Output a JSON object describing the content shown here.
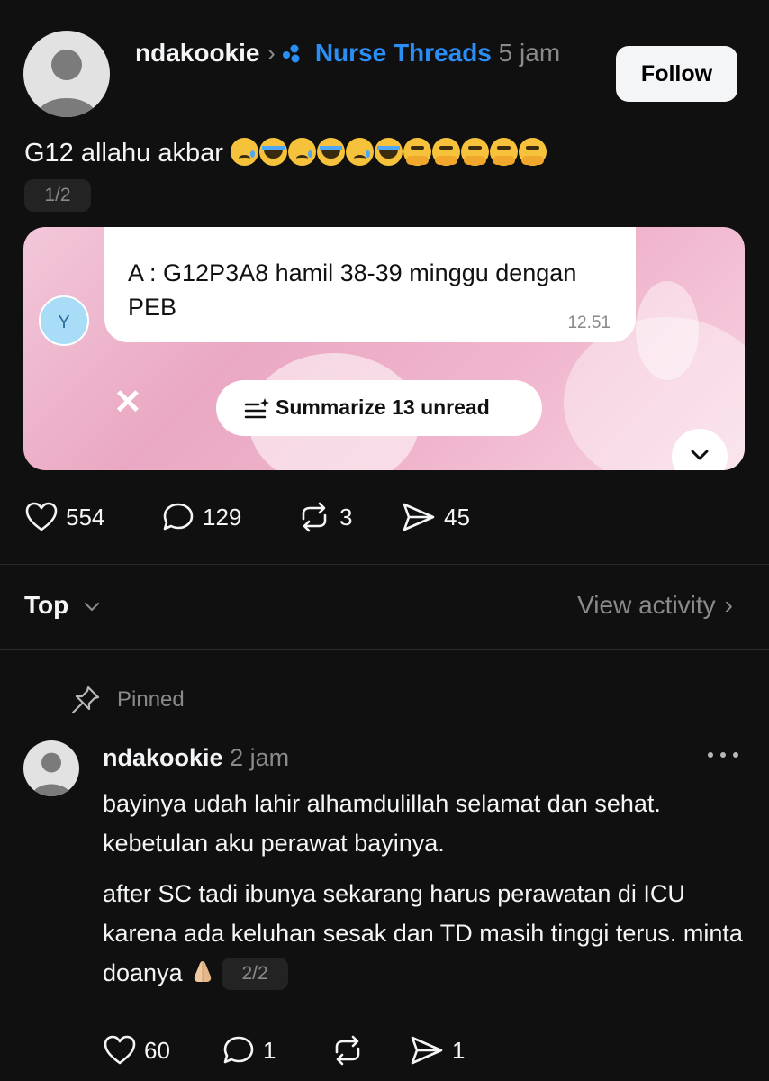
{
  "post": {
    "author": "ndakookie",
    "community": "Nurse Threads",
    "time": "5 jam",
    "follow_label": "Follow",
    "text": "G12 allahu akbar",
    "emojis": [
      "sad",
      "cry",
      "sad",
      "cry",
      "sad",
      "cry",
      "salute",
      "salute",
      "salute",
      "salute",
      "salute"
    ],
    "page_indicator": "1/2",
    "image": {
      "chat_avatar_letter": "Y",
      "message": "A : G12P3A8 hamil 38-39 minggu dengan PEB",
      "message_time": "12.51",
      "summarize_label": "Summarize 13 unread"
    },
    "stats": {
      "likes": "554",
      "comments": "129",
      "reposts": "3",
      "shares": "45"
    }
  },
  "sort_bar": {
    "sort_label": "Top",
    "view_activity_label": "View activity"
  },
  "reply": {
    "pinned_label": "Pinned",
    "author": "ndakookie",
    "time": "2 jam",
    "paragraph1": "bayinya udah lahir alhamdulillah selamat dan sehat. kebetulan aku perawat bayinya.",
    "paragraph2": "after SC tadi ibunya sekarang harus perawatan di ICU karena ada keluhan sesak dan TD masih tinggi terus. minta doanya",
    "page_indicator": "2/2",
    "stats": {
      "likes": "60",
      "comments": "1",
      "reposts": "",
      "shares": "1"
    }
  },
  "colors": {
    "background": "#101010",
    "accent": "#2b8ef5",
    "muted": "#8a8a8a"
  }
}
